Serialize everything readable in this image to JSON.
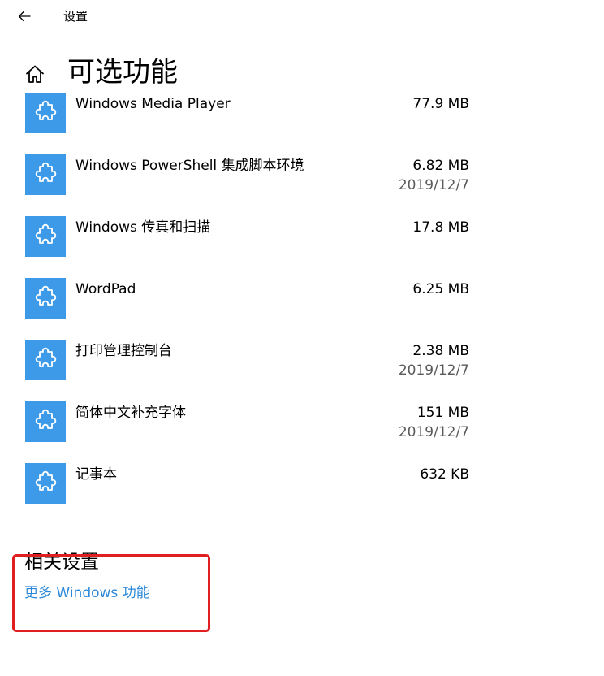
{
  "header": {
    "app_title": "设置",
    "back_icon": "arrow-left-icon"
  },
  "page": {
    "title": "可选功能",
    "home_icon": "home-icon"
  },
  "features": [
    {
      "name": "Windows Media Player",
      "size": "77.9 MB",
      "date": ""
    },
    {
      "name": "Windows PowerShell 集成脚本环境",
      "size": "6.82 MB",
      "date": "2019/12/7"
    },
    {
      "name": "Windows 传真和扫描",
      "size": "17.8 MB",
      "date": ""
    },
    {
      "name": "WordPad",
      "size": "6.25 MB",
      "date": ""
    },
    {
      "name": "打印管理控制台",
      "size": "2.38 MB",
      "date": "2019/12/7"
    },
    {
      "name": "简体中文补充字体",
      "size": "151 MB",
      "date": "2019/12/7"
    },
    {
      "name": "记事本",
      "size": "632 KB",
      "date": ""
    }
  ],
  "related": {
    "heading": "相关设置",
    "link": "更多 Windows 功能"
  },
  "colors": {
    "icon_tile": "#3c9ae8",
    "link": "#2b88d8",
    "highlight": "#e02020",
    "secondary_text": "#5a5a5a"
  }
}
